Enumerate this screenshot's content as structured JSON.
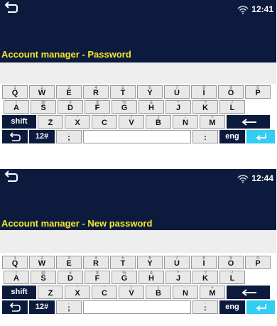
{
  "panels": [
    {
      "time": "12:41",
      "title": "Account manager - Password",
      "field_value": ""
    },
    {
      "time": "12:44",
      "title": "Account manager - New password",
      "field_value": ""
    }
  ],
  "keyboard": {
    "row1": [
      {
        "sec": "1",
        "main": "Q"
      },
      {
        "sec": "2",
        "main": "W"
      },
      {
        "sec": "3",
        "main": "E"
      },
      {
        "sec": "4",
        "main": "R"
      },
      {
        "sec": "5",
        "main": "T"
      },
      {
        "sec": "6",
        "main": "Y"
      },
      {
        "sec": "7",
        "main": "U"
      },
      {
        "sec": "8",
        "main": "I"
      },
      {
        "sec": "9",
        "main": "O"
      },
      {
        "sec": "0",
        "main": "P"
      }
    ],
    "row2": [
      {
        "sec": "!",
        "main": "A"
      },
      {
        "sec": "@",
        "main": "S"
      },
      {
        "sec": "#",
        "main": "D"
      },
      {
        "sec": "$",
        "main": "F"
      },
      {
        "sec": "%",
        "main": "G"
      },
      {
        "sec": "&",
        "main": "H"
      },
      {
        "sec": "*",
        "main": "J"
      },
      {
        "sec": "?",
        "main": "K"
      },
      {
        "sec": "/",
        "main": "L"
      }
    ],
    "row3": [
      {
        "sec": "_",
        "main": "Z"
      },
      {
        "sec": "\"",
        "main": "X"
      },
      {
        "sec": "'",
        "main": "C"
      },
      {
        "sec": "(",
        "main": "V"
      },
      {
        "sec": ")",
        "main": "B"
      },
      {
        "sec": "-",
        "main": "N"
      },
      {
        "sec": "+",
        "main": "M"
      }
    ],
    "shift_label": "shift",
    "numeric_label": "12#",
    "semicolon_key": {
      "sec": ",",
      "main": ";"
    },
    "colon_key": {
      "sec": ".",
      "main": ":"
    },
    "lang_label": "eng"
  },
  "colors": {
    "topbar": "#0c1b3d",
    "title": "#f5ea2c",
    "accent": "#33ccf2"
  },
  "icons": {
    "back": "back-arrow-icon",
    "wifi": "wifi-icon",
    "backspace": "backspace-arrow-icon",
    "enter": "enter-icon"
  }
}
